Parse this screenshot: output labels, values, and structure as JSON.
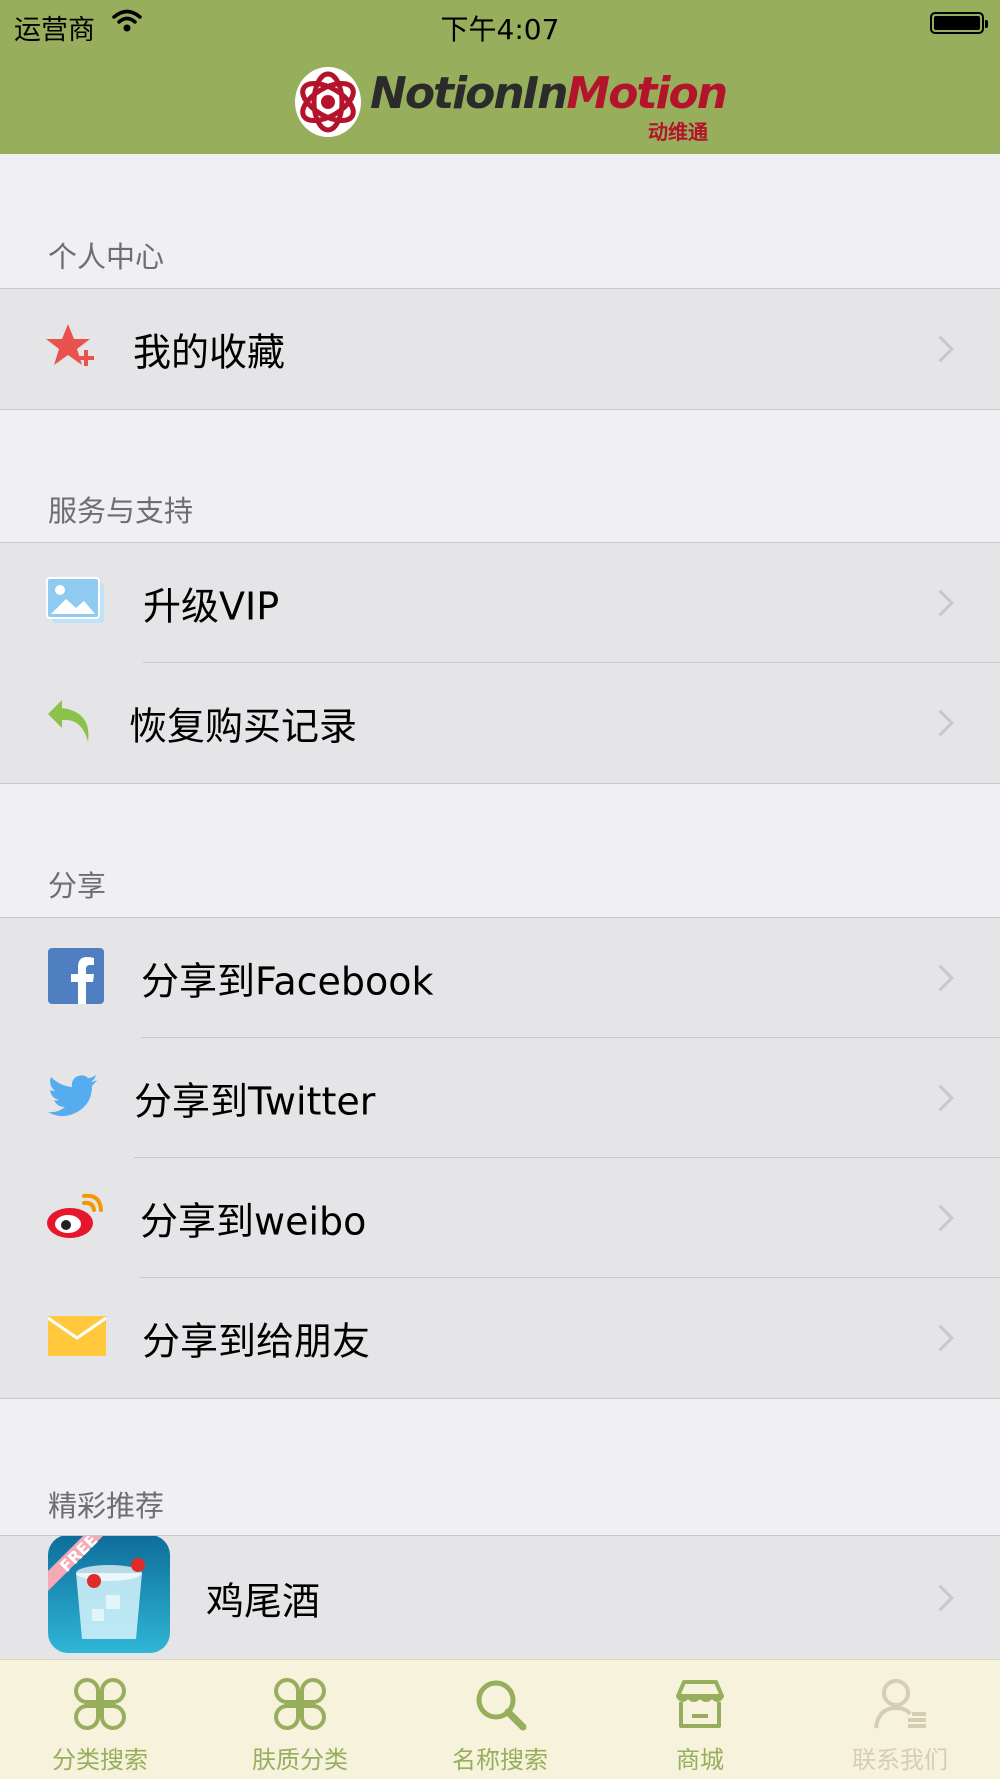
{
  "status_bar": {
    "carrier": "运营商",
    "time": "下午4:07"
  },
  "nav": {
    "logo_text_left": "NotionIn",
    "logo_text_right": "Motion",
    "logo_subtitle": "动维通"
  },
  "sections": [
    {
      "header": "个人中心",
      "items": [
        {
          "label": "我的收藏",
          "icon": "star-plus-icon"
        }
      ]
    },
    {
      "header": "服务与支持",
      "items": [
        {
          "label": "升级VIP",
          "icon": "photo-icon"
        },
        {
          "label": "恢复购买记录",
          "icon": "undo-arrow-icon"
        }
      ]
    },
    {
      "header": "分享",
      "items": [
        {
          "label": "分享到Facebook",
          "icon": "facebook-icon"
        },
        {
          "label": "分享到Twitter",
          "icon": "twitter-icon"
        },
        {
          "label": "分享到weibo",
          "icon": "weibo-icon"
        },
        {
          "label": "分享到给朋友",
          "icon": "envelope-icon"
        }
      ]
    },
    {
      "header": "精彩推荐",
      "items": [
        {
          "label": "鸡尾酒",
          "icon": "cocktail-app-icon",
          "badge": "FREE"
        }
      ]
    }
  ],
  "tabbar": [
    {
      "label": "分类搜索",
      "icon": "clover-icon"
    },
    {
      "label": "肤质分类",
      "icon": "clover-icon"
    },
    {
      "label": "名称搜索",
      "icon": "magnifier-icon"
    },
    {
      "label": "商城",
      "icon": "store-icon"
    },
    {
      "label": "联系我们",
      "icon": "contact-person-icon",
      "state": "dimmed"
    }
  ],
  "colors": {
    "nav_green": "#97ae5c",
    "tab_bg": "#f6f2dc",
    "section_bg": "#efeff4",
    "cell_bg": "#e5e5e8"
  }
}
